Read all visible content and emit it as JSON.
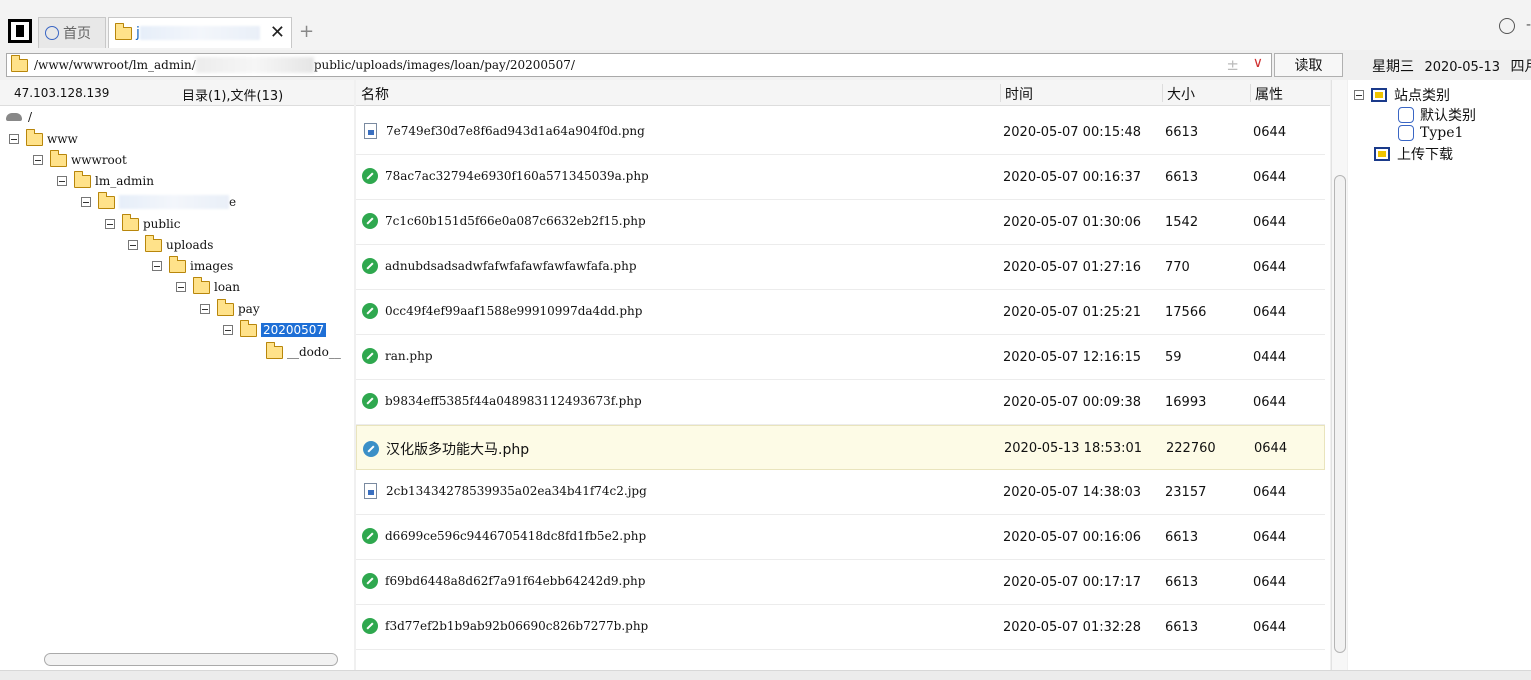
{
  "tabs": {
    "home_label": "首页",
    "site_label_prefix": "j"
  },
  "path": {
    "prefix": "/www/wwwroot/lm_admin/",
    "suffix": "public/uploads/images/loan/pay/20200507/",
    "pm_symbol": "±",
    "dropdown_symbol": "∨",
    "read_button": "读取"
  },
  "datebar": {
    "weekday": "星期三",
    "date": "2020-05-13",
    "cut_label": "四月"
  },
  "left": {
    "ip": "47.103.128.139",
    "count": "目录(1),文件(13)",
    "tree": {
      "root": "/",
      "www": "www",
      "wwwroot": "wwwroot",
      "lm_admin": "lm_admin",
      "site_suffix": "e",
      "public": "public",
      "uploads": "uploads",
      "images": "images",
      "loan": "loan",
      "pay": "pay",
      "selected": "20200507",
      "dodo": "__dodo__"
    }
  },
  "list": {
    "columns": {
      "name": "名称",
      "time": "时间",
      "size": "大小",
      "attr": "属性"
    },
    "rows": [
      {
        "name": "7e749ef30d7e8f6ad943d1a64a904f0d.png",
        "time": "2020-05-07 00:15:48",
        "size": "6613",
        "attr": "0644",
        "icon": "image-file-icon"
      },
      {
        "name": "78ac7ac32794e6930f160a571345039a.php",
        "time": "2020-05-07 00:16:37",
        "size": "6613",
        "attr": "0644",
        "icon": "php-file-icon"
      },
      {
        "name": "7c1c60b151d5f66e0a087c6632eb2f15.php",
        "time": "2020-05-07 01:30:06",
        "size": "1542",
        "attr": "0644",
        "icon": "php-file-icon"
      },
      {
        "name": "adnubdsadsadwfafwfafawfawfawfafa.php",
        "time": "2020-05-07 01:27:16",
        "size": "770",
        "attr": "0644",
        "icon": "php-file-icon"
      },
      {
        "name": "0cc49f4ef99aaf1588e99910997da4dd.php",
        "time": "2020-05-07 01:25:21",
        "size": "17566",
        "attr": "0644",
        "icon": "php-file-icon"
      },
      {
        "name": "ran.php",
        "time": "2020-05-07 12:16:15",
        "size": "59",
        "attr": "0444",
        "icon": "php-file-icon"
      },
      {
        "name": "b9834eff5385f44a048983112493673f.php",
        "time": "2020-05-07 00:09:38",
        "size": "16993",
        "attr": "0644",
        "icon": "php-file-icon"
      },
      {
        "name": "汉化版多功能大马.php",
        "time": "2020-05-13 18:53:01",
        "size": "222760",
        "attr": "0644",
        "icon": "shell-file-icon"
      },
      {
        "name": "2cb13434278539935a02ea34b41f74c2.jpg",
        "time": "2020-05-07 14:38:03",
        "size": "23157",
        "attr": "0644",
        "icon": "image-file-icon"
      },
      {
        "name": "d6699ce596c9446705418dc8fd1fb5e2.php",
        "time": "2020-05-07 00:16:06",
        "size": "6613",
        "attr": "0644",
        "icon": "php-file-icon"
      },
      {
        "name": "f69bd6448a8d62f7a91f64ebb64242d9.php",
        "time": "2020-05-07 00:17:17",
        "size": "6613",
        "attr": "0644",
        "icon": "php-file-icon"
      },
      {
        "name": "f3d77ef2b1b9ab92b06690c826b7277b.php",
        "time": "2020-05-07 01:32:28",
        "size": "6613",
        "attr": "0644",
        "icon": "php-file-icon"
      }
    ]
  },
  "right": {
    "site_category": "站点类别",
    "default_category": "默认类别",
    "type1": "Type1",
    "upload_download": "上传下载"
  }
}
